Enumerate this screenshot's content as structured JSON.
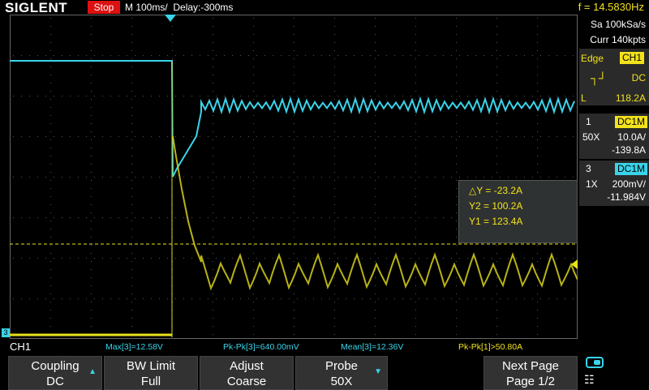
{
  "header": {
    "brand": "SIGLENT",
    "run_state": "Stop",
    "timebase": "M 100ms/",
    "delay": "Delay:-300ms",
    "frequency": "f = 14.5830Hz"
  },
  "acquisition": {
    "sample_rate": "Sa 100kSa/s",
    "memory": "Curr 140kpts"
  },
  "trigger": {
    "mode_label": "Edge",
    "source": "CH1",
    "coupling": "DC",
    "level_label": "L",
    "level": "118.2A"
  },
  "ch1": {
    "number": "1",
    "badge": "DC1M",
    "probe": "50X",
    "scale": "10.0A/",
    "offset": "-139.8A"
  },
  "ch3": {
    "number": "3",
    "badge": "DC1M",
    "probe": "1X",
    "scale": "200mV/",
    "offset": "-11.984V",
    "ground_marker": "3"
  },
  "cursors": {
    "delta_y": "△Y = -23.2A",
    "y2": "Y2 = 100.2A",
    "y1": "Y1 = 123.4A"
  },
  "status": {
    "active_channel": "CH1",
    "max3": "Max[3]=12.58V",
    "pkpk3": "Pk-Pk[3]=640.00mV",
    "mean3": "Mean[3]=12.36V",
    "pkpk1": "Pk-Pk[1]>50.80A"
  },
  "softkeys": [
    {
      "top": "Coupling",
      "bottom": "DC",
      "arrow": "▲"
    },
    {
      "top": "BW Limit",
      "bottom": "Full",
      "arrow": ""
    },
    {
      "top": "Adjust",
      "bottom": "Coarse",
      "arrow": ""
    },
    {
      "top": "Probe",
      "bottom": "50X",
      "arrow": "▼"
    },
    {
      "top": "Next Page",
      "bottom": "Page 1/2",
      "arrow": ""
    }
  ],
  "colors": {
    "ch1": "#e8e21b",
    "ch3": "#3ad4ea",
    "stop": "#d11111",
    "grid": "#555555"
  },
  "icons": {
    "toggle": "toggle-icon",
    "network": "network-icon"
  }
}
